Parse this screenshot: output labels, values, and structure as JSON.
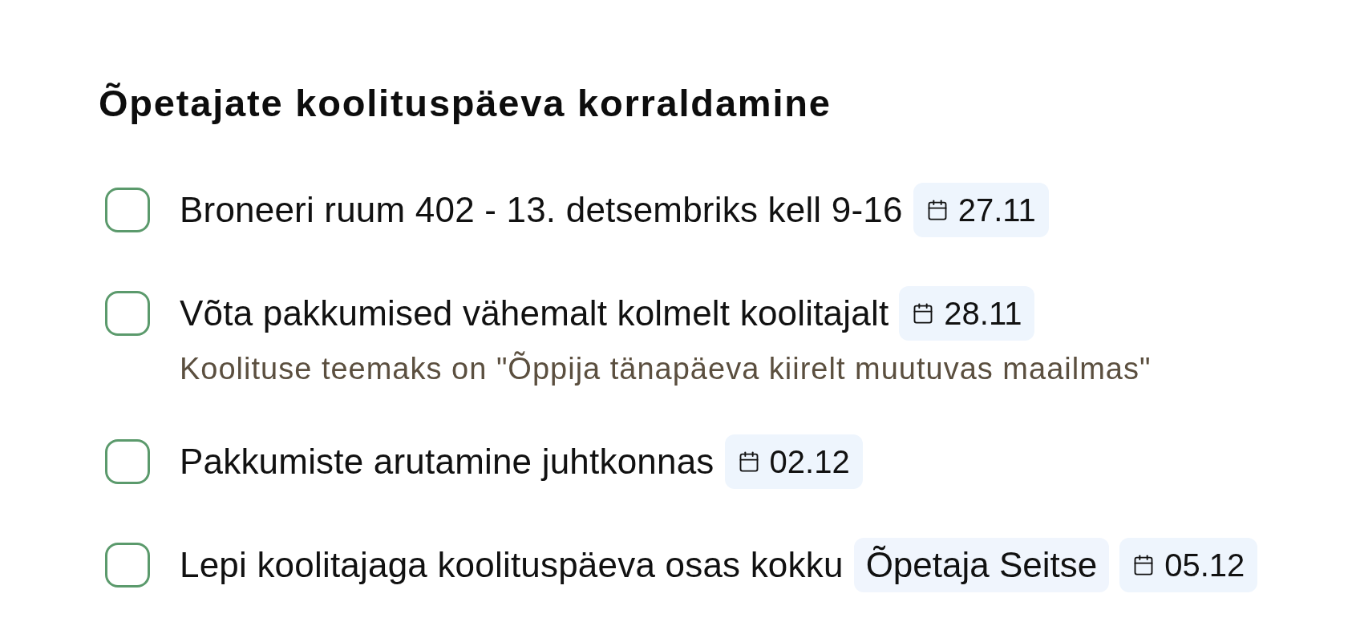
{
  "title": "Õpetajate koolituspäeva korraldamine",
  "tasks": [
    {
      "label": "Broneeri ruum 402 - 13. detsembriks kell 9-16",
      "checked": false,
      "tags": [
        {
          "kind": "date",
          "text": "27.11"
        }
      ]
    },
    {
      "label": "Võta pakkumised vähemalt kolmelt koolitajalt",
      "checked": false,
      "tags": [
        {
          "kind": "date",
          "text": "28.11"
        }
      ],
      "note": "Koolituse teemaks on \"Õppija tänapäeva kiirelt muutuvas maailmas\""
    },
    {
      "label": "Pakkumiste arutamine juhtkonnas",
      "checked": false,
      "tags": [
        {
          "kind": "date",
          "text": "02.12"
        }
      ]
    },
    {
      "label": "Lepi koolitajaga koolituspäeva osas kokku",
      "checked": false,
      "tags": [
        {
          "kind": "assignee",
          "text": "Õpetaja Seitse"
        },
        {
          "kind": "date",
          "text": "05.12"
        }
      ]
    }
  ]
}
